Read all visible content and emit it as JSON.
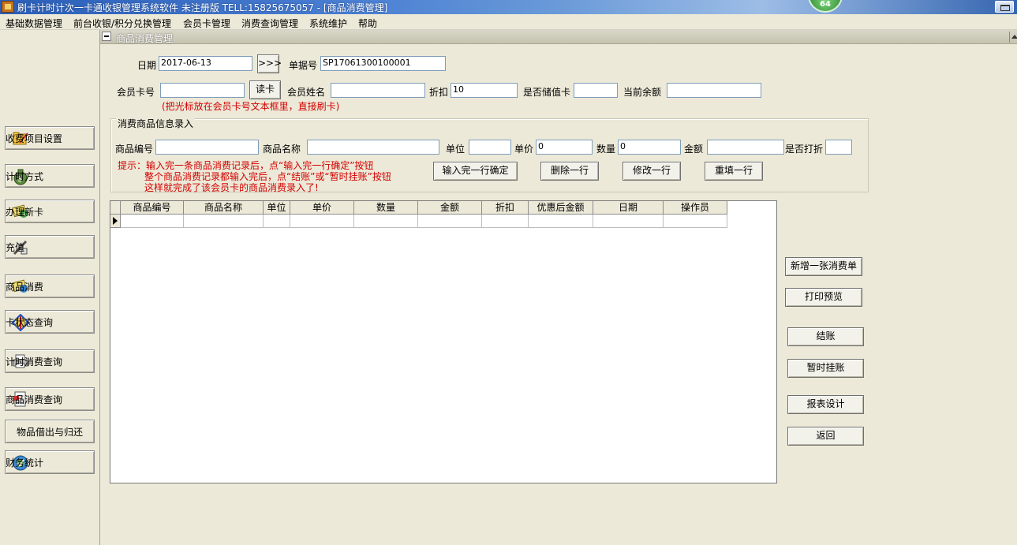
{
  "window": {
    "title": "刷卡计时计次一卡通收银管理系统软件  未注册版 TELL:15825675057 - [商品消费管理]",
    "badge": "64"
  },
  "menu": [
    "基础数据管理",
    "前台收银/积分兑换管理",
    "会员卡管理",
    "消费查询管理",
    "系统维护",
    "帮助"
  ],
  "sidebar": {
    "items": [
      {
        "label": "收费项目设置",
        "icon": "folder-edit-icon"
      },
      {
        "label": "计时方式",
        "icon": "money-bag-icon"
      },
      {
        "label": "办理新卡",
        "icon": "new-card-icon"
      },
      {
        "label": "充值",
        "icon": "pen-tools-icon"
      },
      {
        "label": "商品消费",
        "icon": "card-consume-icon"
      },
      {
        "label": "卡状态查询",
        "icon": "card-status-icon"
      },
      {
        "label": "计时消费查询",
        "icon": "printer-icon"
      },
      {
        "label": "商品消费查询",
        "icon": "document-query-icon"
      },
      {
        "label": "物品借出与归还",
        "icon": ""
      },
      {
        "label": "财务统计",
        "icon": "finance-icon"
      }
    ]
  },
  "child": {
    "title": "商品消费管理"
  },
  "form": {
    "date_label": "日期",
    "date_value": "2017-06-13",
    "next_button": ">>>",
    "receipt_label": "单据号",
    "receipt_value": "SP17061300100001",
    "card_no_label": "会员卡号",
    "card_no_value": "",
    "read_card_button": "读卡",
    "member_name_label": "会员姓名",
    "member_name_value": "",
    "discount_label": "折扣",
    "discount_value": "10",
    "stored_card_label": "是否储值卡",
    "stored_card_value": "",
    "balance_label": "当前余额",
    "balance_value": "",
    "card_hint": "(把光标放在会员卡号文本框里，直接刷卡)"
  },
  "entry": {
    "group_title": "消费商品信息录入",
    "code_label": "商品编号",
    "code_value": "",
    "name_label": "商品名称",
    "name_value": "",
    "unit_label": "单位",
    "unit_value": "",
    "price_label": "单价",
    "price_value": "0",
    "qty_label": "数量",
    "qty_value": "0",
    "amount_label": "金额",
    "amount_value": "",
    "discounted_label": "是否打折",
    "discounted_value": "",
    "hint_line1": "提示：输入完一条商品消费记录后，点“输入完一行确定”按钮",
    "hint_line2": "整个商品消费记录都输入完后，点“结账”或“暂时挂账”按钮",
    "hint_line3": "这样就完成了该会员卡的商品消费录入了!",
    "confirm_row_button": "输入完一行确定",
    "delete_row_button": "删除一行",
    "edit_row_button": "修改一行",
    "refill_row_button": "重填一行"
  },
  "grid": {
    "columns": [
      "商品编号",
      "商品名称",
      "单位",
      "单价",
      "数量",
      "金额",
      "折扣",
      "优惠后金额",
      "日期",
      "操作员"
    ]
  },
  "actions": {
    "new_bill": "新增一张消费单",
    "print_preview": "打印预览",
    "checkout": "结账",
    "hold": "暂时挂账",
    "report_design": "报表设计",
    "back": "返回"
  }
}
